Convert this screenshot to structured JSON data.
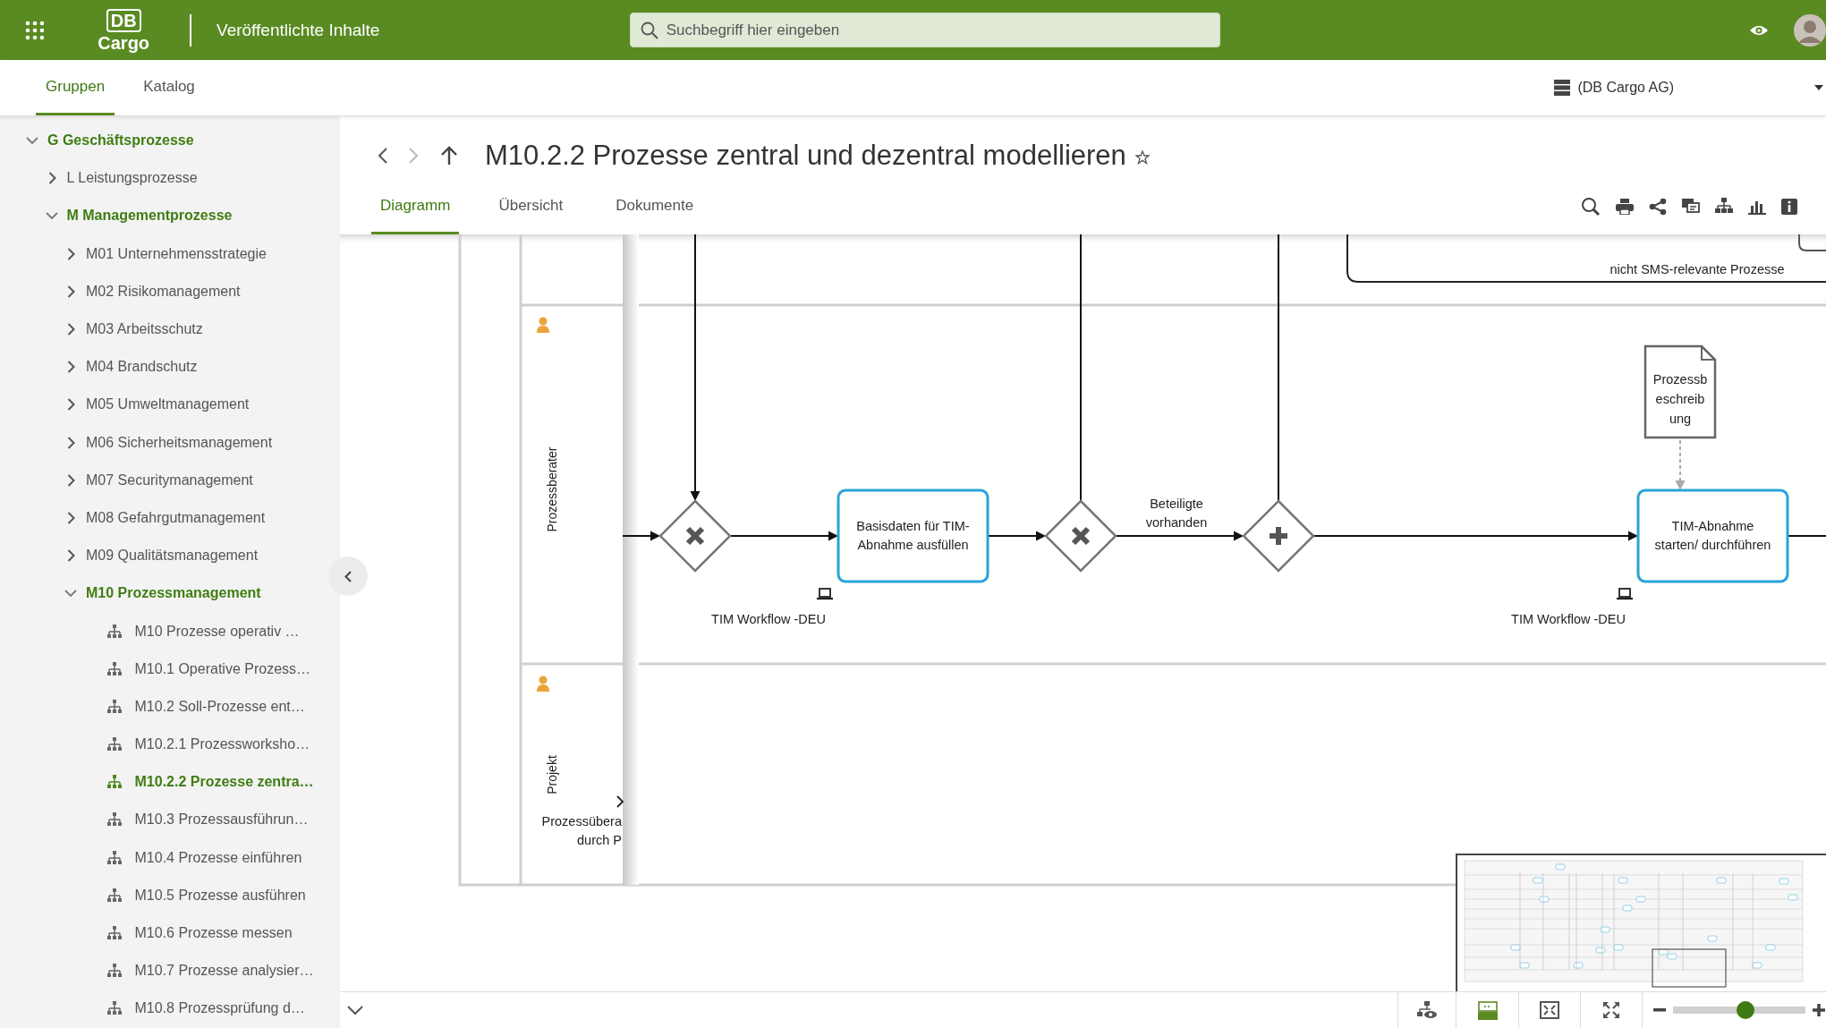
{
  "header": {
    "logo": {
      "top": "DB",
      "bottom": "Cargo"
    },
    "app_title": "Veröffentlichte Inhalte",
    "search": {
      "placeholder": "Suchbegriff hier eingeben"
    }
  },
  "nav_tabs": [
    {
      "label": "Gruppen",
      "selected": true
    },
    {
      "label": "Katalog",
      "selected": false
    }
  ],
  "organization": "(DB Cargo AG)",
  "sidebar": {
    "tree": [
      {
        "label": "G Geschäftsprozesse",
        "expanded": true,
        "children": [
          {
            "label": "L Leistungsprozesse",
            "expanded": false
          },
          {
            "label": "M Managementprozesse",
            "expanded": true,
            "children": [
              {
                "label": "M01 Unternehmensstrategie",
                "expanded": false
              },
              {
                "label": "M02 Risikomanagement",
                "expanded": false
              },
              {
                "label": "M03 Arbeitsschutz",
                "expanded": false
              },
              {
                "label": "M04 Brandschutz",
                "expanded": false
              },
              {
                "label": "M05 Umweltmanagement",
                "expanded": false
              },
              {
                "label": "M06 Sicherheitsmanagement",
                "expanded": false
              },
              {
                "label": "M07 Securitymanagement",
                "expanded": false
              },
              {
                "label": "M08 Gefahrgutmanagement",
                "expanded": false
              },
              {
                "label": "M09 Qualitätsmanagement",
                "expanded": false
              },
              {
                "label": "M10 Prozessmanagement",
                "expanded": true,
                "children": [
                  {
                    "label": "M10 Prozesse operativ …",
                    "selected": false
                  },
                  {
                    "label": "M10.1 Operative Prozess…",
                    "selected": false
                  },
                  {
                    "label": "M10.2 Soll-Prozesse ent…",
                    "selected": false
                  },
                  {
                    "label": "M10.2.1 Prozessworksho…",
                    "selected": false
                  },
                  {
                    "label": "M10.2.2 Prozesse zentra…",
                    "selected": true
                  },
                  {
                    "label": "M10.3 Prozessausführun…",
                    "selected": false
                  },
                  {
                    "label": "M10.4 Prozesse einführen",
                    "selected": false
                  },
                  {
                    "label": "M10.5 Prozesse ausführen",
                    "selected": false
                  },
                  {
                    "label": "M10.6 Prozesse messen",
                    "selected": false
                  },
                  {
                    "label": "M10.7 Prozesse analysier…",
                    "selected": false
                  },
                  {
                    "label": "M10.8 Prozessprüfung d…",
                    "selected": false
                  }
                ]
              }
            ]
          }
        ]
      }
    ]
  },
  "page": {
    "title": "M10.2.2 Prozesse zentral und dezentral modellieren",
    "favorite": false,
    "forward_enabled": false,
    "tabs": [
      {
        "label": "Diagramm",
        "selected": true
      },
      {
        "label": "Übersicht",
        "selected": false
      },
      {
        "label": "Dokumente",
        "selected": false
      }
    ]
  },
  "diagram": {
    "group_label": "nicht SMS-relevante Prozesse",
    "lanes": [
      {
        "label": "Prozessberater"
      },
      {
        "label": "Projekt"
      }
    ],
    "gateways": [
      {
        "kind": "exclusive"
      },
      {
        "kind": "exclusive"
      },
      {
        "kind": "parallel"
      }
    ],
    "tasks": [
      {
        "lines": [
          "Basisdaten für TIM-",
          "Abnahme ausfüllen"
        ],
        "system": "TIM Workflow -DEU"
      },
      {
        "lines": [
          "TIM-Abnahme",
          "starten/ durchführen"
        ],
        "system": "TIM Workflow -DEU"
      }
    ],
    "flow_label": [
      "Beteiligte",
      "vorhanden"
    ],
    "document": [
      "Prozessb",
      "eschreib",
      "ung"
    ],
    "partial_label": [
      "Prozessübera",
      "durch P"
    ]
  },
  "minimap": {
    "visible": true
  },
  "zoom": {
    "level": 0.55
  }
}
